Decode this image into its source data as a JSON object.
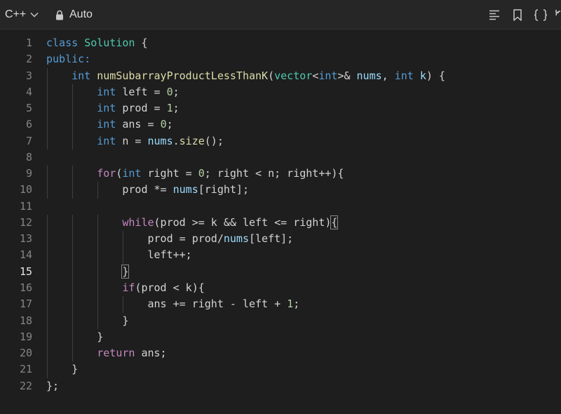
{
  "toolbar": {
    "language": "C++",
    "mode": "Auto",
    "icons": [
      "chevron-down-icon",
      "lock-icon",
      "format-icon",
      "bookmark-icon",
      "braces-icon",
      "reset-icon"
    ]
  },
  "editor": {
    "active_line": 15,
    "line_numbers": [
      "1",
      "2",
      "3",
      "4",
      "5",
      "6",
      "7",
      "8",
      "9",
      "10",
      "11",
      "12",
      "13",
      "14",
      "15",
      "16",
      "17",
      "18",
      "19",
      "20",
      "21",
      "22"
    ],
    "lines": [
      {
        "indent": 0,
        "tokens": [
          {
            "t": "class",
            "c": "kw"
          },
          {
            "t": " "
          },
          {
            "t": "Solution",
            "c": "ty"
          },
          {
            "t": " {"
          }
        ]
      },
      {
        "indent": 0,
        "tokens": [
          {
            "t": "public:",
            "c": "kw"
          }
        ]
      },
      {
        "indent": 1,
        "tokens": [
          {
            "t": "int",
            "c": "kw"
          },
          {
            "t": " "
          },
          {
            "t": "numSubarrayProductLessThanK",
            "c": "fn"
          },
          {
            "t": "("
          },
          {
            "t": "vector",
            "c": "ty"
          },
          {
            "t": "<"
          },
          {
            "t": "int",
            "c": "kw"
          },
          {
            "t": ">& "
          },
          {
            "t": "nums",
            "c": "var"
          },
          {
            "t": ", "
          },
          {
            "t": "int",
            "c": "kw"
          },
          {
            "t": " "
          },
          {
            "t": "k",
            "c": "var"
          },
          {
            "t": ") {"
          }
        ]
      },
      {
        "indent": 2,
        "tokens": [
          {
            "t": "int",
            "c": "kw"
          },
          {
            "t": " left = "
          },
          {
            "t": "0",
            "c": "num"
          },
          {
            "t": ";"
          }
        ]
      },
      {
        "indent": 2,
        "tokens": [
          {
            "t": "int",
            "c": "kw"
          },
          {
            "t": " prod = "
          },
          {
            "t": "1",
            "c": "num"
          },
          {
            "t": ";"
          }
        ]
      },
      {
        "indent": 2,
        "tokens": [
          {
            "t": "int",
            "c": "kw"
          },
          {
            "t": " ans = "
          },
          {
            "t": "0",
            "c": "num"
          },
          {
            "t": ";"
          }
        ]
      },
      {
        "indent": 2,
        "tokens": [
          {
            "t": "int",
            "c": "kw"
          },
          {
            "t": " n = "
          },
          {
            "t": "nums",
            "c": "var"
          },
          {
            "t": "."
          },
          {
            "t": "size",
            "c": "fn"
          },
          {
            "t": "();"
          }
        ]
      },
      {
        "indent": 0,
        "tokens": []
      },
      {
        "indent": 2,
        "tokens": [
          {
            "t": "for",
            "c": "ctl"
          },
          {
            "t": "("
          },
          {
            "t": "int",
            "c": "kw"
          },
          {
            "t": " right = "
          },
          {
            "t": "0",
            "c": "num"
          },
          {
            "t": "; right < n; right++){"
          }
        ]
      },
      {
        "indent": 3,
        "tokens": [
          {
            "t": "prod *= "
          },
          {
            "t": "nums",
            "c": "var"
          },
          {
            "t": "[right];"
          }
        ]
      },
      {
        "indent": 0,
        "tokens": []
      },
      {
        "indent": 3,
        "tokens": [
          {
            "t": "while",
            "c": "ctl"
          },
          {
            "t": "(prod >= k && left <= right)"
          },
          {
            "t": "{",
            "c": "bm"
          }
        ]
      },
      {
        "indent": 4,
        "tokens": [
          {
            "t": "prod = prod/"
          },
          {
            "t": "nums",
            "c": "var"
          },
          {
            "t": "[left];"
          }
        ]
      },
      {
        "indent": 4,
        "tokens": [
          {
            "t": "left++;"
          }
        ]
      },
      {
        "indent": 3,
        "tokens": [
          {
            "t": "}",
            "c": "bm"
          }
        ]
      },
      {
        "indent": 3,
        "tokens": [
          {
            "t": "if",
            "c": "ctl"
          },
          {
            "t": "(prod < k){"
          }
        ]
      },
      {
        "indent": 4,
        "tokens": [
          {
            "t": "ans += right - left + "
          },
          {
            "t": "1",
            "c": "num"
          },
          {
            "t": ";"
          }
        ]
      },
      {
        "indent": 3,
        "tokens": [
          {
            "t": "}"
          }
        ]
      },
      {
        "indent": 2,
        "tokens": [
          {
            "t": "}"
          }
        ]
      },
      {
        "indent": 2,
        "tokens": [
          {
            "t": "return",
            "c": "ctl"
          },
          {
            "t": " ans;"
          }
        ]
      },
      {
        "indent": 1,
        "tokens": [
          {
            "t": "}"
          }
        ]
      },
      {
        "indent": 0,
        "tokens": [
          {
            "t": "};"
          }
        ]
      }
    ]
  },
  "colors": {
    "background": "#1e1e1e",
    "keyword": "#569cd6",
    "type": "#4ec9b0",
    "function": "#dcdcaa",
    "variable": "#9cdcfe",
    "number": "#b5cea8",
    "control": "#c586c0"
  }
}
